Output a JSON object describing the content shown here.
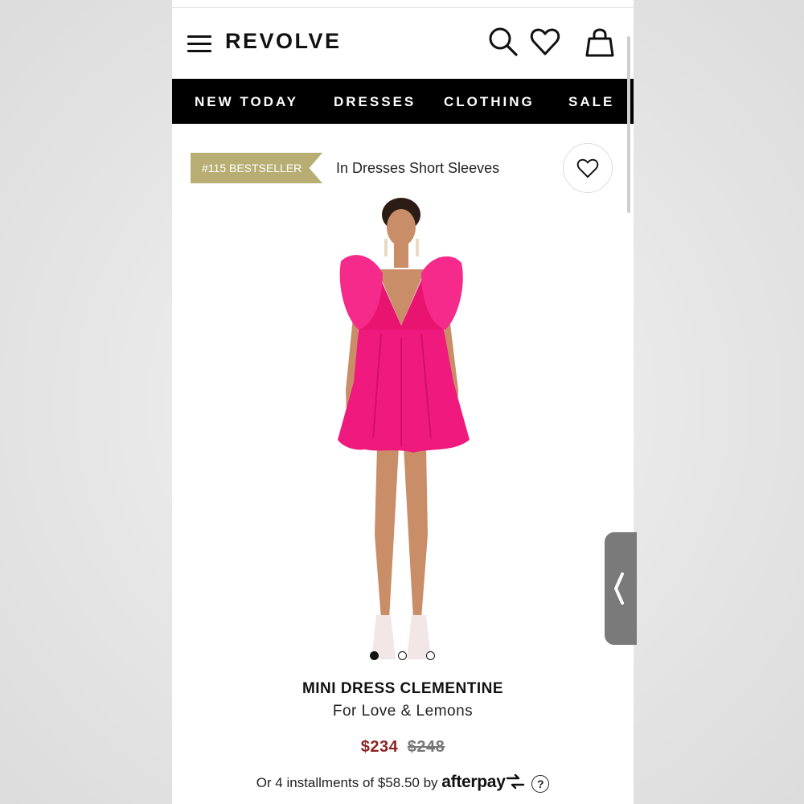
{
  "header": {
    "logo": "REVOLVE"
  },
  "nav": {
    "items": [
      "NEW TODAY",
      "DRESSES",
      "CLOTHING",
      "SALE"
    ]
  },
  "badge": {
    "text": "#115 BESTSELLER",
    "category": "In Dresses Short Sleeves"
  },
  "product": {
    "title": "MINI DRESS CLEMENTINE",
    "brand": "For Love & Lemons",
    "price_sale": "$234",
    "price_original": "$248",
    "installments_prefix": "Or 4 installments of $58.50 by",
    "afterpay_label": "afterpay",
    "help_label": "?",
    "dress_color": "#f0197d",
    "image_dots": {
      "count": 3,
      "active": 1
    }
  },
  "colors": {
    "nav_bg": "#000000",
    "badge_bg": "#b8ad73",
    "sale_price": "#8b2323"
  }
}
